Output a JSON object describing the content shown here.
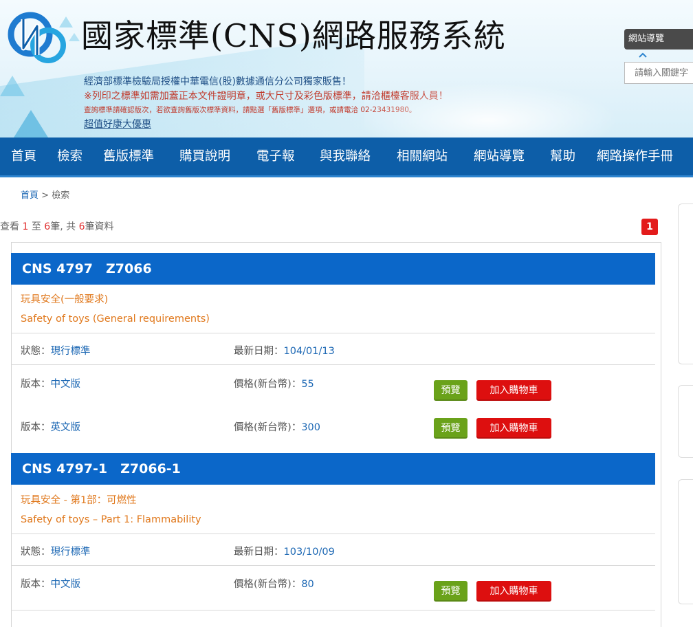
{
  "header": {
    "title": "國家標準(CNS)網路服務系統",
    "tagline1": "經濟部標準檢驗局授權中華電信(股)數據通信分公司獨家販售！",
    "tagline2": "※列印之標準如需加蓋正本文件證明章，或大尺寸及彩色版標準，請洽櫃檯客服人員！",
    "tagline3": "查詢標準請確認版次，若欲查詢舊版次標準資料，請點選「舊版標準」選項，或請電洽 02-23431980。",
    "promo_link": "超值好康大優惠",
    "site_nav_button": "網站導覽",
    "search_placeholder": "請輸入關鍵字"
  },
  "nav": {
    "items": [
      "首頁",
      "檢索",
      "舊版標準",
      "購買說明",
      "電子報",
      "與我聯絡",
      "相關網站",
      "網站導覽",
      "幫助",
      "網路操作手冊"
    ]
  },
  "breadcrumb": {
    "home": "首頁",
    "sep": ">",
    "current": "檢索"
  },
  "summary": {
    "prefix": "查看",
    "from": "1",
    "to_word": "至",
    "to": "6",
    "unit": "筆, 共",
    "total": "6",
    "suffix": "筆資料"
  },
  "pagination": {
    "current_page": "1"
  },
  "labels": {
    "status": "狀態：",
    "latest_date": "最新日期：",
    "edition": "版本：",
    "price": "價格(新台幣)：",
    "preview": "預覽",
    "add_to_cart": "加入購物車"
  },
  "results": [
    {
      "code": "CNS 4797　Z7066",
      "title_zh": "玩具安全(一般要求)",
      "title_en": "Safety of toys (General requirements)",
      "status": "現行標準",
      "latest_date": "104/01/13",
      "editions": [
        {
          "edition": "中文版",
          "price": "55"
        },
        {
          "edition": "英文版",
          "price": "300"
        }
      ]
    },
    {
      "code": "CNS 4797-1　Z7066-1",
      "title_zh": "玩具安全 - 第1部：可燃性",
      "title_en": "Safety of toys – Part 1: Flammability",
      "status": "現行標準",
      "latest_date": "103/10/09",
      "editions": [
        {
          "edition": "中文版",
          "price": "80"
        }
      ]
    }
  ],
  "colors": {
    "nav_bg": "#0d5ea8",
    "result_header_bg": "#0b67c9",
    "title_orange": "#e0781c",
    "value_blue": "#1a66b3",
    "preview_green": "#6aa21a",
    "cart_red": "#dd0f0f",
    "badge_red": "#e31b1b"
  }
}
